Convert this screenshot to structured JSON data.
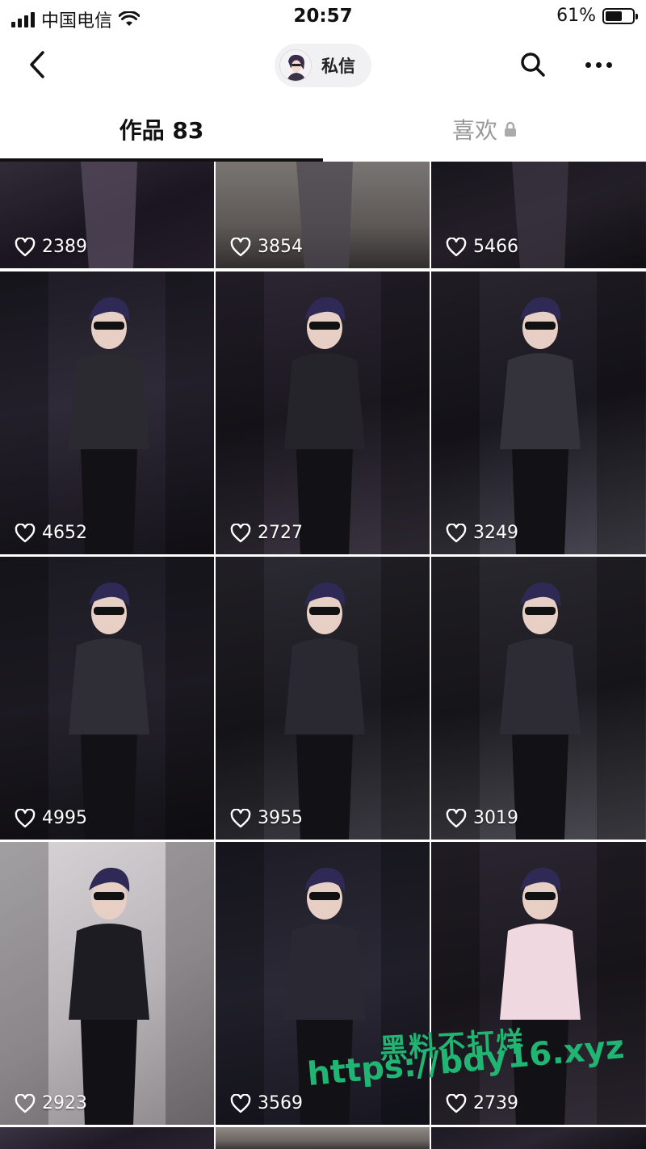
{
  "status_bar": {
    "carrier": "中国电信",
    "time": "20:57",
    "battery_percent": "61%",
    "battery_level": 0.61,
    "icons": [
      "signal-icon",
      "wifi-icon",
      "battery-icon"
    ]
  },
  "nav": {
    "back_icon": "chevron-left-icon",
    "dm_label": "私信",
    "search_icon": "search-icon",
    "more_icon": "more-icon"
  },
  "tabs": {
    "works": "作品 83",
    "likes": "喜欢",
    "likes_icon": "lock-icon"
  },
  "videos": [
    {
      "likes": "2389"
    },
    {
      "likes": "3854"
    },
    {
      "likes": "5466"
    },
    {
      "likes": "4652"
    },
    {
      "likes": "2727"
    },
    {
      "likes": "3249"
    },
    {
      "likes": "4995"
    },
    {
      "likes": "3955"
    },
    {
      "likes": "3019"
    },
    {
      "likes": "2923"
    },
    {
      "likes": "3569"
    },
    {
      "likes": "2739"
    }
  ],
  "watermark": {
    "line1": "黑料不打烊",
    "line2": "https://bdy16.xyz"
  },
  "colors": {
    "watermark": "#20b573",
    "tab_inactive": "#999999"
  }
}
